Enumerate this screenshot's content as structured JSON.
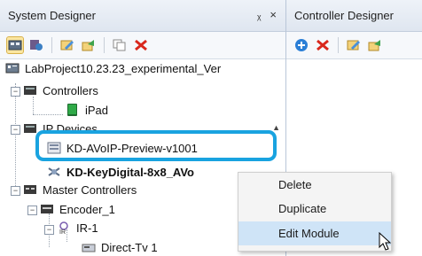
{
  "left_panel": {
    "title": "System Designer",
    "pin_glyph": "ᵪ",
    "close_glyph": "×",
    "toolbar_icons": [
      "system-view-icon",
      "device-library-icon",
      "edit-icon",
      "export-icon",
      "copy-icon",
      "delete-icon"
    ],
    "tree": {
      "root": "LabProject10.23.23_experimental_Ver",
      "controllers": "Controllers",
      "ipad": "iPad",
      "ip_devices": "IP Devices",
      "avoip_preview": "KD-AVoIP-Preview-v1001",
      "keydigital": "KD-KeyDigital-8x8_AVo",
      "master_controllers": "Master Controllers",
      "encoder": "Encoder_1",
      "ir": "IR-1",
      "direct_tv": "Direct-Tv 1"
    }
  },
  "right_panel": {
    "title": "Controller Designer",
    "toolbar_icons": [
      "add-icon",
      "delete-icon",
      "edit-icon",
      "export-icon"
    ]
  },
  "context_menu": {
    "items": [
      "Delete",
      "Duplicate",
      "Edit Module"
    ],
    "active_item": "Edit Module"
  },
  "colors": {
    "highlight_ring": "#19a3e0",
    "menu_active": "#cfe4f7",
    "delete_red": "#d9271c",
    "add_blue": "#2b7fd6"
  }
}
